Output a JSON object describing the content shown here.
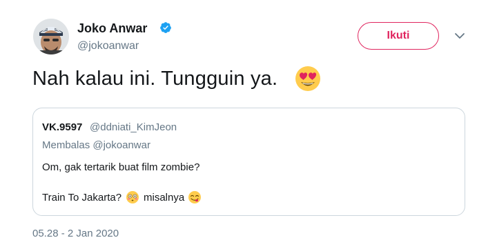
{
  "author": {
    "name": "Joko Anwar",
    "handle": "@jokoanwar",
    "verified": true,
    "avatar_icon": "profile-photo"
  },
  "actions": {
    "follow_label": "Ikuti",
    "menu_icon": "chevron-down-icon"
  },
  "tweet": {
    "text": "Nah kalau ini. Tungguin ya.",
    "emoji_icon": "heart-eyes-emoji"
  },
  "quoted": {
    "name": "VK.9597",
    "handle": "@ddniati_KimJeon",
    "reply_context": "Membalas @jokoanwar",
    "line1": "Om, gak tertarik buat film zombie?",
    "line2": "Train To Jakarta?",
    "line2_suffix": "misalnya",
    "emoji1_icon": "flushed-face-emoji",
    "emoji2_icon": "yum-face-emoji"
  },
  "timestamp": "05.28 - 2 Jan 2020",
  "colors": {
    "follow_accent": "#e0245e",
    "verified_blue": "#1da1f2",
    "secondary_text": "#657786",
    "border": "#ccd6dd"
  }
}
